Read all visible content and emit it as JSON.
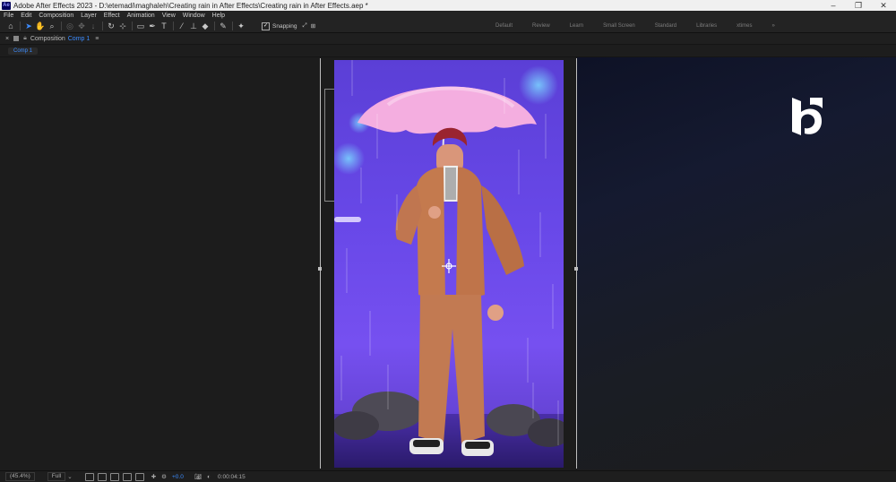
{
  "window": {
    "title": "Adobe After Effects 2023 - D:\\etemadi\\maghaleh\\Creating rain in After Effects\\Creating rain in After Effects.aep *",
    "app_icon": "Ae",
    "controls": [
      "–",
      "❐",
      "✕"
    ]
  },
  "menu": [
    "File",
    "Edit",
    "Composition",
    "Layer",
    "Effect",
    "Animation",
    "View",
    "Window",
    "Help"
  ],
  "toolbar": {
    "snapping_label": "Snapping",
    "workspaces": [
      "Default",
      "Review",
      "Learn",
      "Small Screen",
      "Standard",
      "Libraries",
      "xtimes",
      "»"
    ]
  },
  "panel": {
    "label": "Composition",
    "comp_name": "Comp 1",
    "menu_glyph": "≡",
    "close_glyph": "×"
  },
  "tabs": [
    {
      "label": "Comp 1"
    }
  ],
  "status": {
    "zoom": "(45.4%)",
    "resolution": "Full",
    "exposure": "+0.0",
    "timecode": "0:00:04:15"
  },
  "colors": {
    "accent": "#3c8cff",
    "comp_bg": "#6b4ae6"
  },
  "icons": {
    "home": "home-icon",
    "selection": "selection-arrow-icon",
    "hand": "hand-icon",
    "zoom": "zoom-icon",
    "camera": "snapshot-camera-icon"
  }
}
